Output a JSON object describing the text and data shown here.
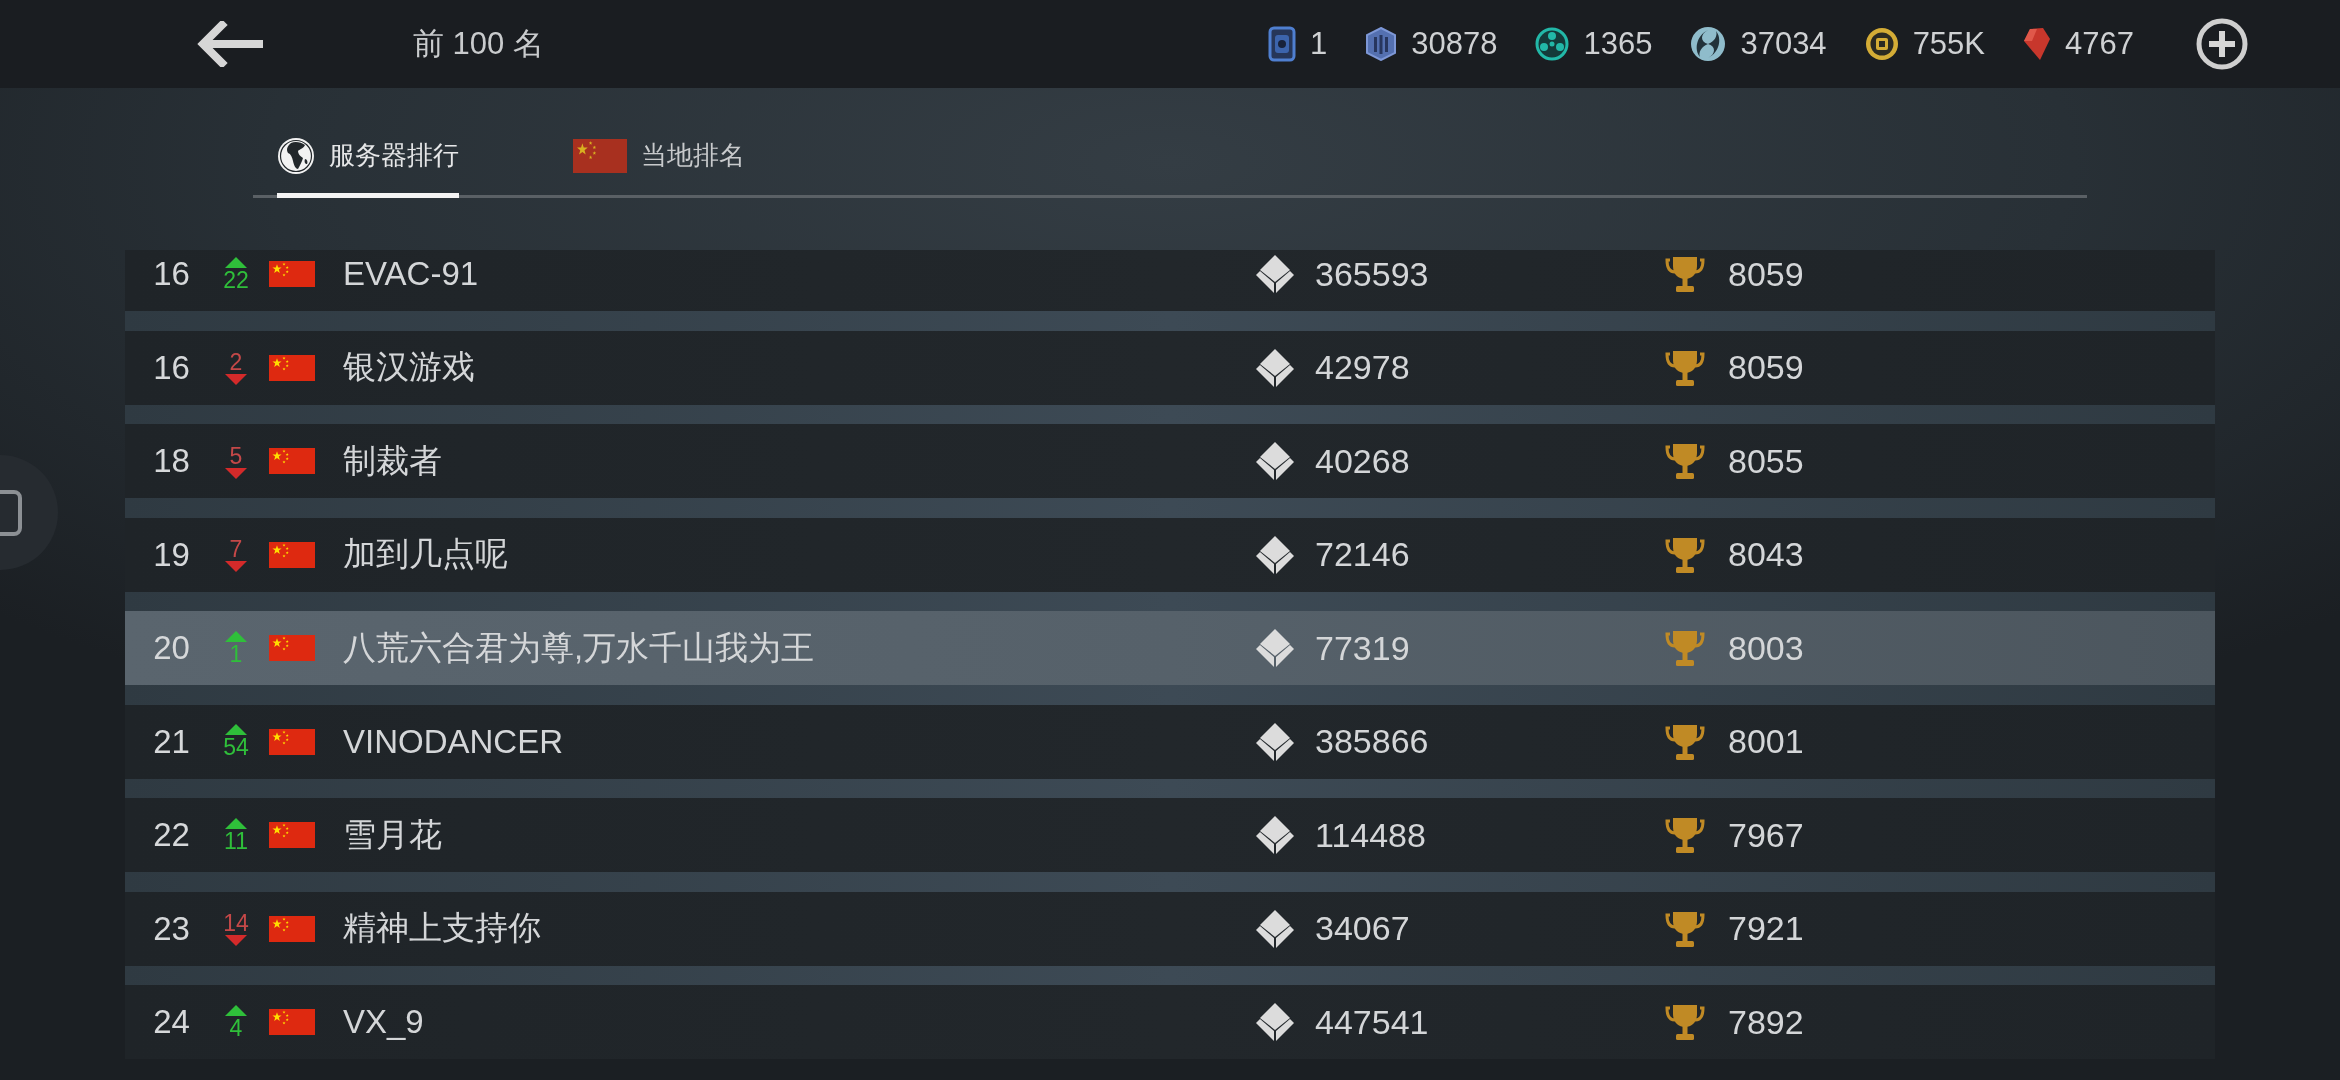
{
  "top_bar": {
    "title": "前 100 名",
    "currencies": [
      "1",
      "30878",
      "1365",
      "37034",
      "755K",
      "4767"
    ]
  },
  "tabs": [
    {
      "label": "服务器排行",
      "kind": "global",
      "selected": true
    },
    {
      "label": "当地排名",
      "kind": "local",
      "selected": false
    }
  ],
  "rows": [
    {
      "rank": "16",
      "rank_up": true,
      "change": "22",
      "name": "EVAC-91",
      "score": "365593",
      "trophies": "8059",
      "highlighted": false
    },
    {
      "rank": "16",
      "rank_up": false,
      "change": "2",
      "name": "银汉游戏",
      "score": "42978",
      "trophies": "8059",
      "highlighted": false
    },
    {
      "rank": "18",
      "rank_up": false,
      "change": "5",
      "name": "制裁者",
      "score": "40268",
      "trophies": "8055",
      "highlighted": false
    },
    {
      "rank": "19",
      "rank_up": false,
      "change": "7",
      "name": "加到几点呢",
      "score": "72146",
      "trophies": "8043",
      "highlighted": false
    },
    {
      "rank": "20",
      "rank_up": true,
      "change": "1",
      "name": "八荒六合君为尊,万水千山我为王",
      "score": "77319",
      "trophies": "8003",
      "highlighted": true
    },
    {
      "rank": "21",
      "rank_up": true,
      "change": "54",
      "name": "VINODANCER",
      "score": "385866",
      "trophies": "8001",
      "highlighted": false
    },
    {
      "rank": "22",
      "rank_up": true,
      "change": "11",
      "name": "雪月花",
      "score": "114488",
      "trophies": "7967",
      "highlighted": false
    },
    {
      "rank": "23",
      "rank_up": false,
      "change": "14",
      "name": "精神上支持你",
      "score": "34067",
      "trophies": "7921",
      "highlighted": false
    },
    {
      "rank": "24",
      "rank_up": true,
      "change": "4",
      "name": "VX_9",
      "score": "447541",
      "trophies": "7892",
      "highlighted": false
    }
  ]
}
